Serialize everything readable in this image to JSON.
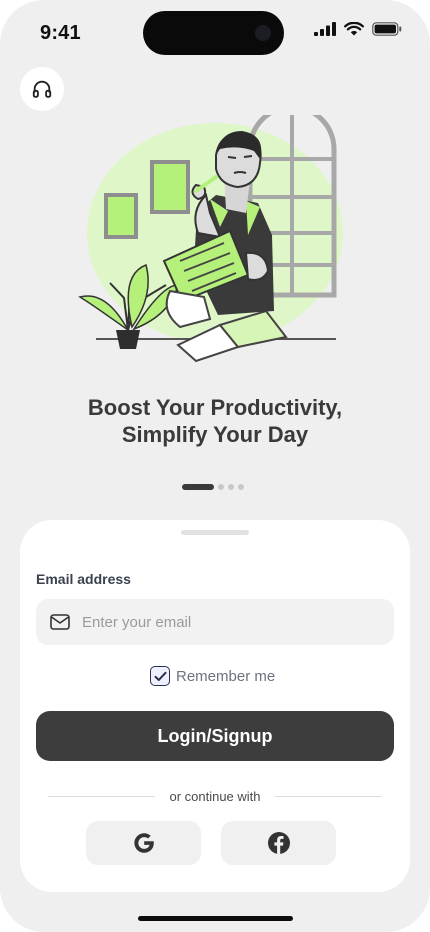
{
  "status_bar": {
    "time": "9:41",
    "icons": [
      "cellular-signal-icon",
      "wifi-icon",
      "battery-icon"
    ]
  },
  "header": {
    "support_icon": "headphones-icon"
  },
  "hero": {
    "illustration": "man-reviewing-checklist-illustration",
    "accent_color": "#dff7c8",
    "highlight_color": "#b5f07b"
  },
  "headline": {
    "line1": "Boost Your Productivity,",
    "line2": "Simplify Your Day"
  },
  "pager": {
    "count": 4,
    "active_index": 0
  },
  "form": {
    "email_label": "Email address",
    "email_placeholder": "Enter your email",
    "email_value": "",
    "remember_label": "Remember me",
    "remember_checked": true,
    "login_label": "Login/Signup",
    "divider_text": "or continue with",
    "social": [
      "google-icon",
      "facebook-icon"
    ]
  },
  "colors": {
    "background": "#efefef",
    "card": "#ffffff",
    "primary_button": "#3d3d3d",
    "input_bg": "#f2f2f2"
  }
}
